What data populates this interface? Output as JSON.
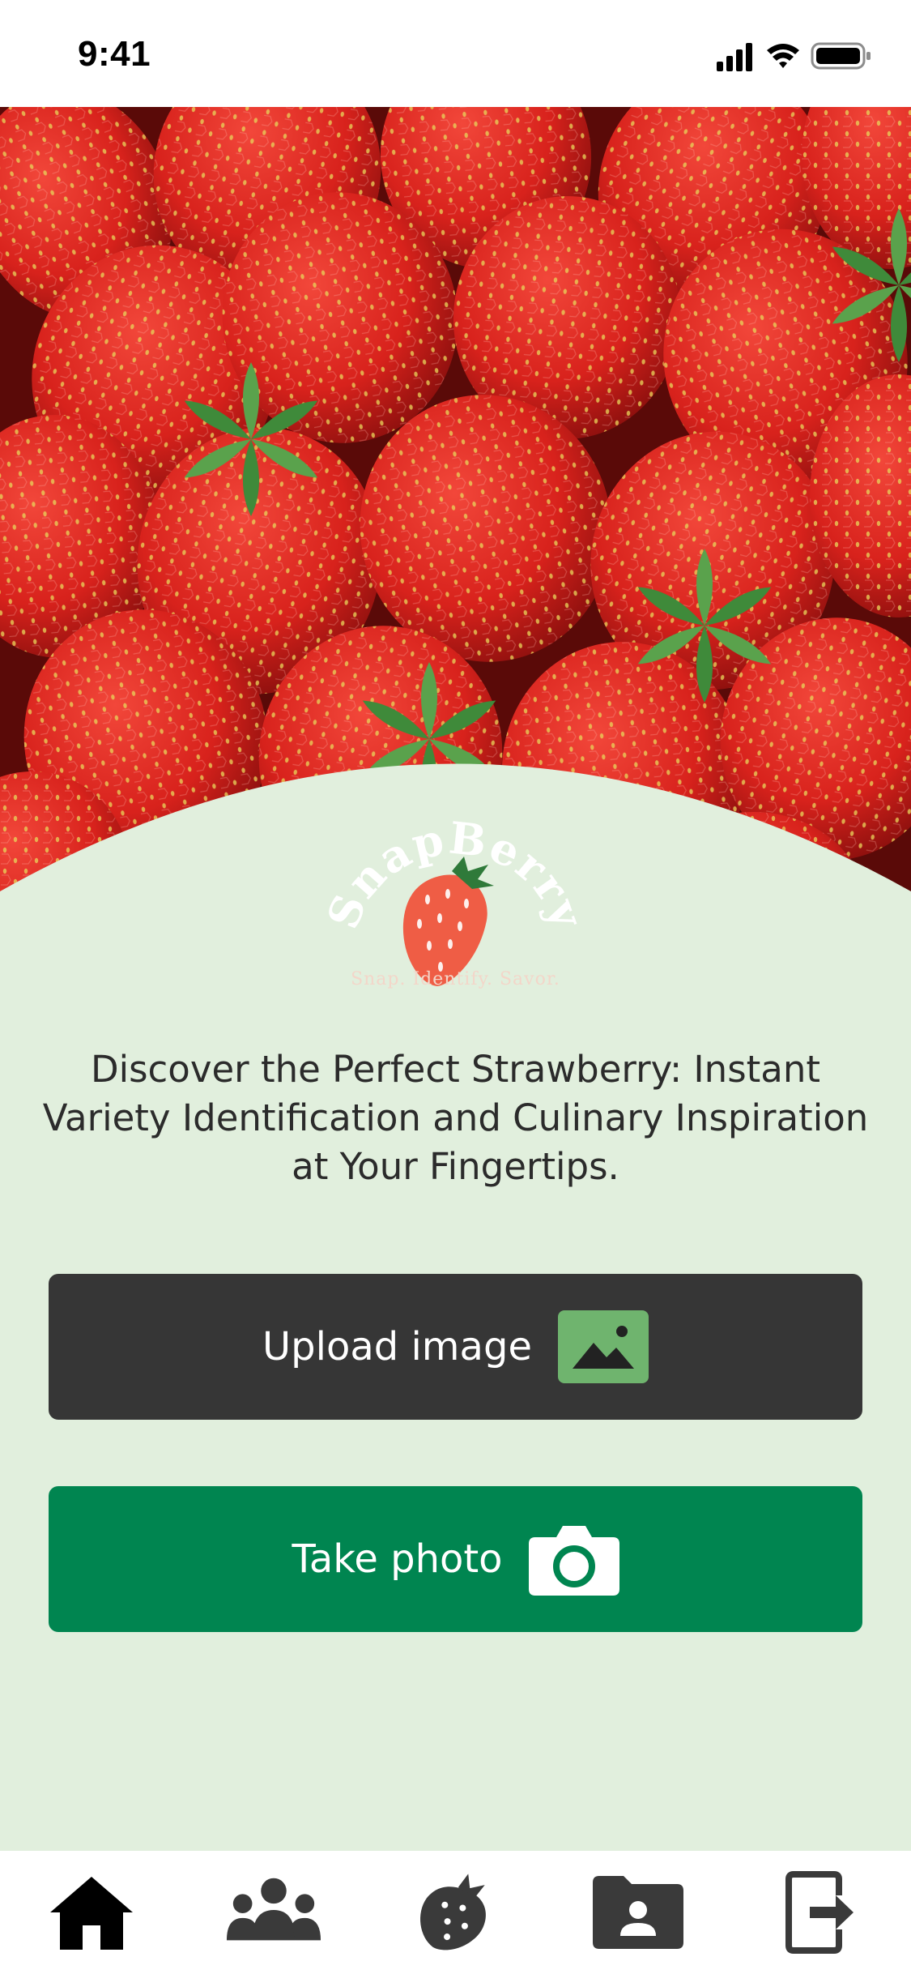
{
  "status_bar": {
    "time": "9:41",
    "icons": [
      "cellular-signal-icon",
      "wifi-icon",
      "battery-icon"
    ]
  },
  "hero": {
    "image": "strawberries-photo"
  },
  "brand": {
    "name": "SnapBerry",
    "tagline": "Snap. Identify. Savor."
  },
  "headline": "Discover the Perfect Strawberry: Instant Variety Identification and Culinary Inspiration at Your Fingertips.",
  "actions": {
    "upload": {
      "label": "Upload image",
      "icon": "image-icon",
      "color": "#363636"
    },
    "photo": {
      "label": "Take photo",
      "icon": "camera-icon",
      "color": "#008550"
    }
  },
  "tab_bar": {
    "items": [
      {
        "icon": "home-icon",
        "active": true
      },
      {
        "icon": "community-icon",
        "active": false
      },
      {
        "icon": "strawberry-icon",
        "active": false
      },
      {
        "icon": "contact-folder-icon",
        "active": false
      },
      {
        "icon": "logout-icon",
        "active": false
      }
    ]
  },
  "colors": {
    "background": "#e1efdd",
    "strawberry": "#e8523c",
    "leaf": "#2f7a3a",
    "text": "#2b2b2b"
  }
}
